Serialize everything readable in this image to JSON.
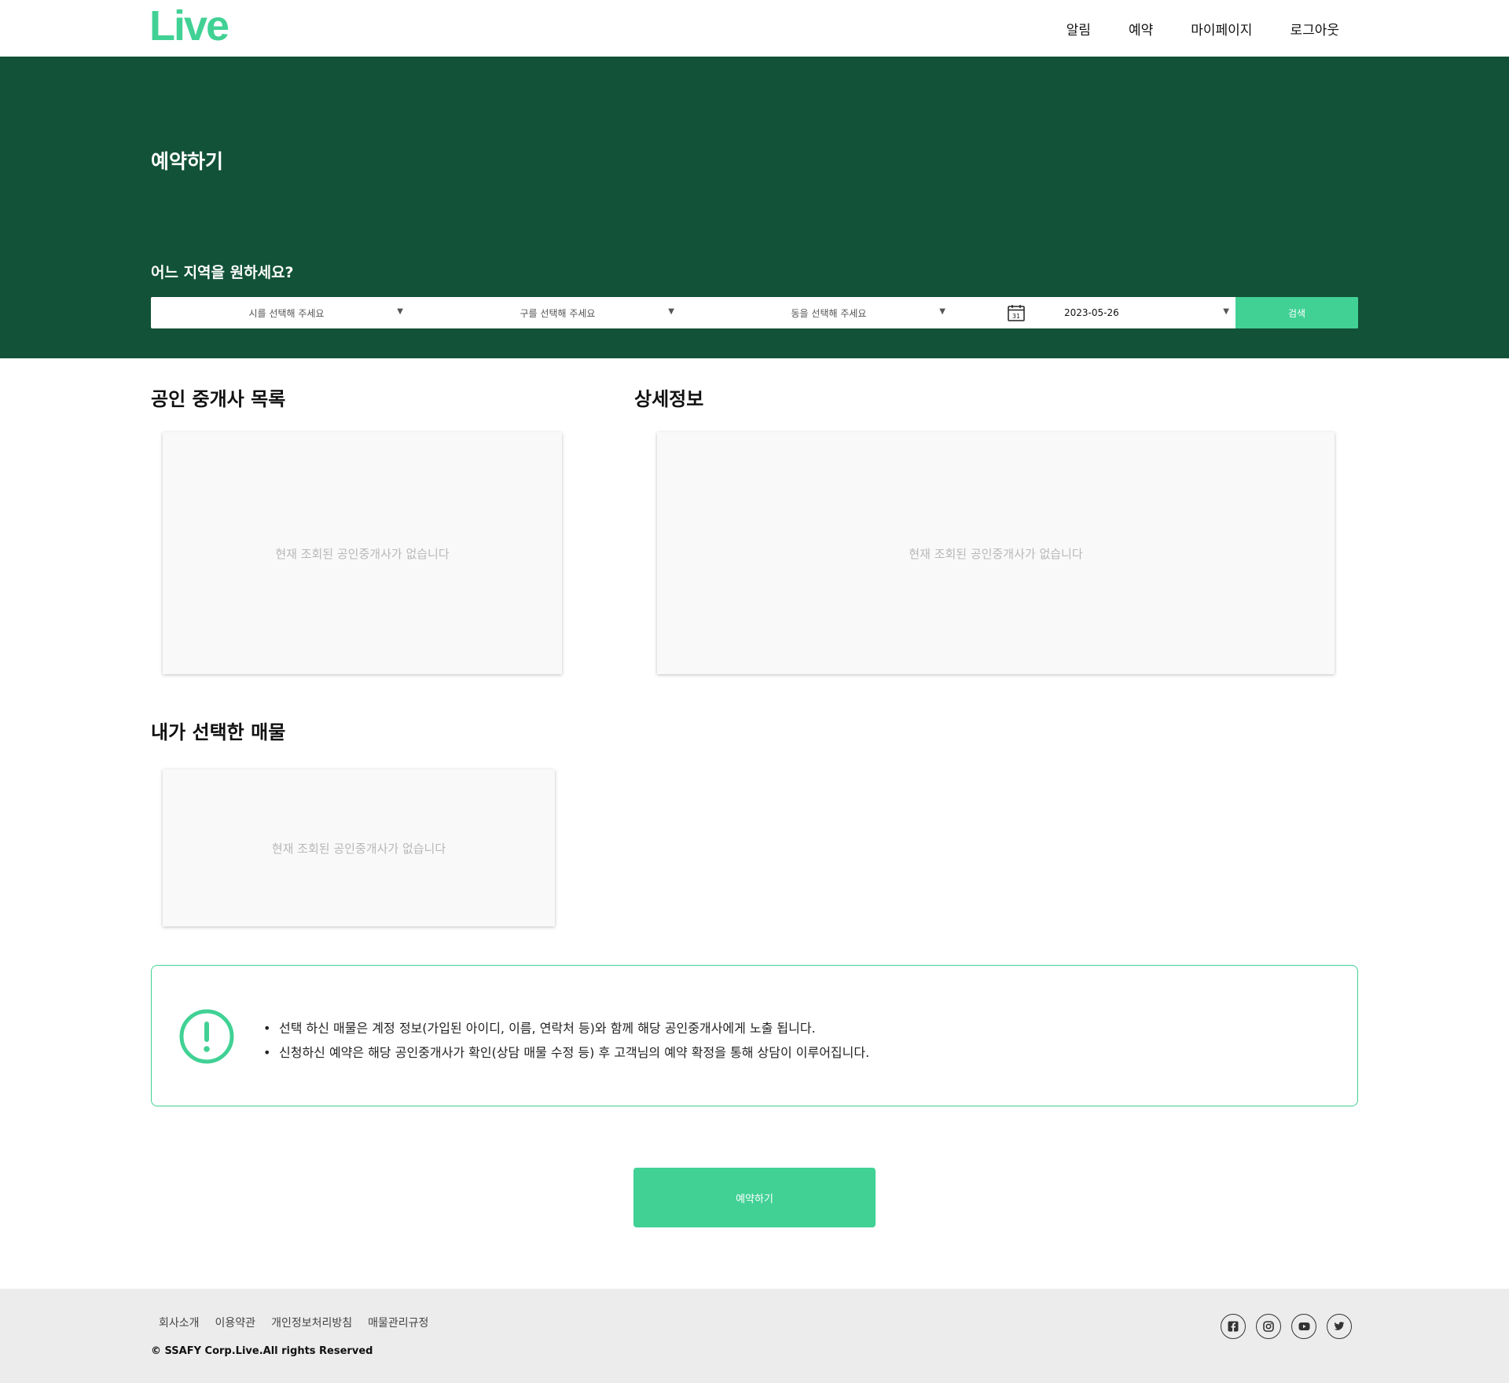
{
  "header": {
    "logo": "Live",
    "nav": [
      "알림",
      "예약",
      "마이페이지",
      "로그아웃"
    ]
  },
  "hero": {
    "title": "예약하기",
    "subtitle": "어느 지역을 원하세요?",
    "selects": {
      "city": "시를 선택해 주세요",
      "district": "구를 선택해 주세요",
      "dong": "동을 선택해 주세요"
    },
    "date": "2023-05-26",
    "calendar_day": "31",
    "search_label": "검색"
  },
  "sections": {
    "agent_list_title": "공인 중개사 목록",
    "detail_title": "상세정보",
    "my_listing_title": "내가 선택한 매물",
    "empty_message": "현재 조회된 공인중개사가 없습니다"
  },
  "notice": {
    "items": [
      "선택 하신 매물은 계정 정보(가입된 아이디, 이름, 연락처 등)와 함께 해당 공인중개사에게 노출 됩니다.",
      "신청하신 예약은 해당 공인중개사가 확인(상담 매물 수정 등) 후 고객님의 예약 확정을 통해 상담이 이루어집니다."
    ]
  },
  "reserve_button": "예약하기",
  "footer": {
    "links": [
      "회사소개",
      "이용약관",
      "개인정보처리방침",
      "매물관리규정"
    ],
    "copyright": "© SSAFY Corp.Live.All rights Reserved",
    "socials": [
      "facebook-icon",
      "instagram-icon",
      "youtube-icon",
      "twitter-icon"
    ]
  },
  "colors": {
    "brand_green": "#41d195",
    "dark_green": "#125238"
  }
}
